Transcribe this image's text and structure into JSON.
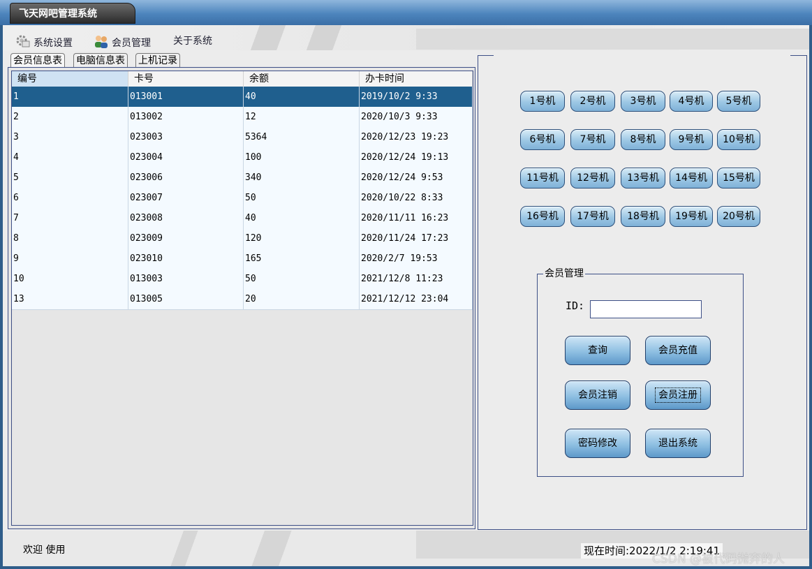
{
  "window": {
    "title": "飞天网吧管理系统"
  },
  "menu": {
    "items": [
      {
        "label": "系统设置",
        "icon": "gear-icon"
      },
      {
        "label": "会员管理",
        "icon": "users-icon"
      },
      {
        "label": "关于系统"
      }
    ]
  },
  "tabs": [
    {
      "label": "会员信息表",
      "active": true
    },
    {
      "label": "电脑信息表",
      "active": false
    },
    {
      "label": "上机记录",
      "active": false
    }
  ],
  "table": {
    "columns": [
      "编号",
      "卡号",
      "余额",
      "办卡时间"
    ],
    "rows": [
      [
        "1",
        "013001",
        "40",
        "2019/10/2 9:33"
      ],
      [
        "2",
        "013002",
        "12",
        "2020/10/3 9:33"
      ],
      [
        "3",
        "023003",
        "5364",
        "2020/12/23 19:23"
      ],
      [
        "4",
        "023004",
        "100",
        "2020/12/24 19:13"
      ],
      [
        "5",
        "023006",
        "340",
        "2020/12/24 9:53"
      ],
      [
        "6",
        "023007",
        "50",
        "2020/10/22 8:33"
      ],
      [
        "7",
        "023008",
        "40",
        "2020/11/11 16:23"
      ],
      [
        "8",
        "023009",
        "120",
        "2020/11/24 17:23"
      ],
      [
        "9",
        "023010",
        "165",
        "2020/2/7 19:53"
      ],
      [
        "10",
        "013003",
        "50",
        "2021/12/8 11:23"
      ],
      [
        "13",
        "013005",
        "20",
        "2021/12/12 23:04"
      ]
    ],
    "selected_row": 0
  },
  "computers": [
    "1号机",
    "2号机",
    "3号机",
    "4号机",
    "5号机",
    "6号机",
    "7号机",
    "8号机",
    "9号机",
    "10号机",
    "11号机",
    "12号机",
    "13号机",
    "14号机",
    "15号机",
    "16号机",
    "17号机",
    "18号机",
    "19号机",
    "20号机"
  ],
  "member_panel": {
    "title": "会员管理",
    "id_label": "ID:",
    "id_value": "",
    "buttons": {
      "query": "查询",
      "recharge": "会员充值",
      "cancel": "会员注销",
      "register": "会员注册",
      "password": "密码修改",
      "exit": "退出系统"
    }
  },
  "status": {
    "welcome": "欢迎 使用",
    "time": "现在时间:2022/1/2 2:19:41"
  },
  "watermark": "CSDN @被代码抛弃的人"
}
